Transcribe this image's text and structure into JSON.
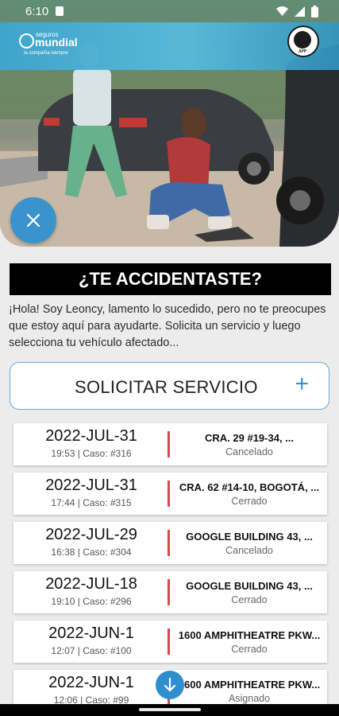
{
  "status_bar": {
    "time": "6:10"
  },
  "hero": {
    "brand_small": "seguros",
    "brand_name": "mundial",
    "brand_tagline": "la compañía siempre",
    "badge_text": "APP"
  },
  "alert": {
    "title": "¿TE ACCIDENTASTE?",
    "intro": "¡Hola! Soy Leoncy, lamento lo sucedido, pero no te preocupes que estoy aquí para ayudarte. Solicita un servicio y luego selecciona tu vehículo afectado..."
  },
  "request_button": {
    "label": "SOLICITAR SERVICIO",
    "plus": "+"
  },
  "cases": [
    {
      "date": "2022-JUL-31",
      "meta": "19:53 | Caso: #316",
      "address": "CRA. 29 #19-34, ...",
      "status": "Cancelado"
    },
    {
      "date": "2022-JUL-31",
      "meta": "17:44 | Caso: #315",
      "address": "CRA. 62 #14-10, BOGOTÁ, ...",
      "status": "Cerrado"
    },
    {
      "date": "2022-JUL-29",
      "meta": "16:38 | Caso: #304",
      "address": "GOOGLE BUILDING 43, ...",
      "status": "Cancelado"
    },
    {
      "date": "2022-JUL-18",
      "meta": "19:10 | Caso: #296",
      "address": "GOOGLE BUILDING 43, ...",
      "status": "Cerrado"
    },
    {
      "date": "2022-JUN-1",
      "meta": "12:07 | Caso: #100",
      "address": "1600 AMPHITHEATRE PKW...",
      "status": "Cerrado"
    },
    {
      "date": "2022-JUN-1",
      "meta": "12:06 | Caso: #99",
      "address": "1600 AMPHITHEATRE PKW...",
      "status": "Asignado"
    }
  ],
  "colors": {
    "accent": "#3a93cd",
    "divider": "#d84b4b",
    "title_bg": "#000000"
  },
  "icons": {
    "close": "close-icon",
    "scroll": "arrow-down-icon",
    "add": "plus-icon"
  }
}
